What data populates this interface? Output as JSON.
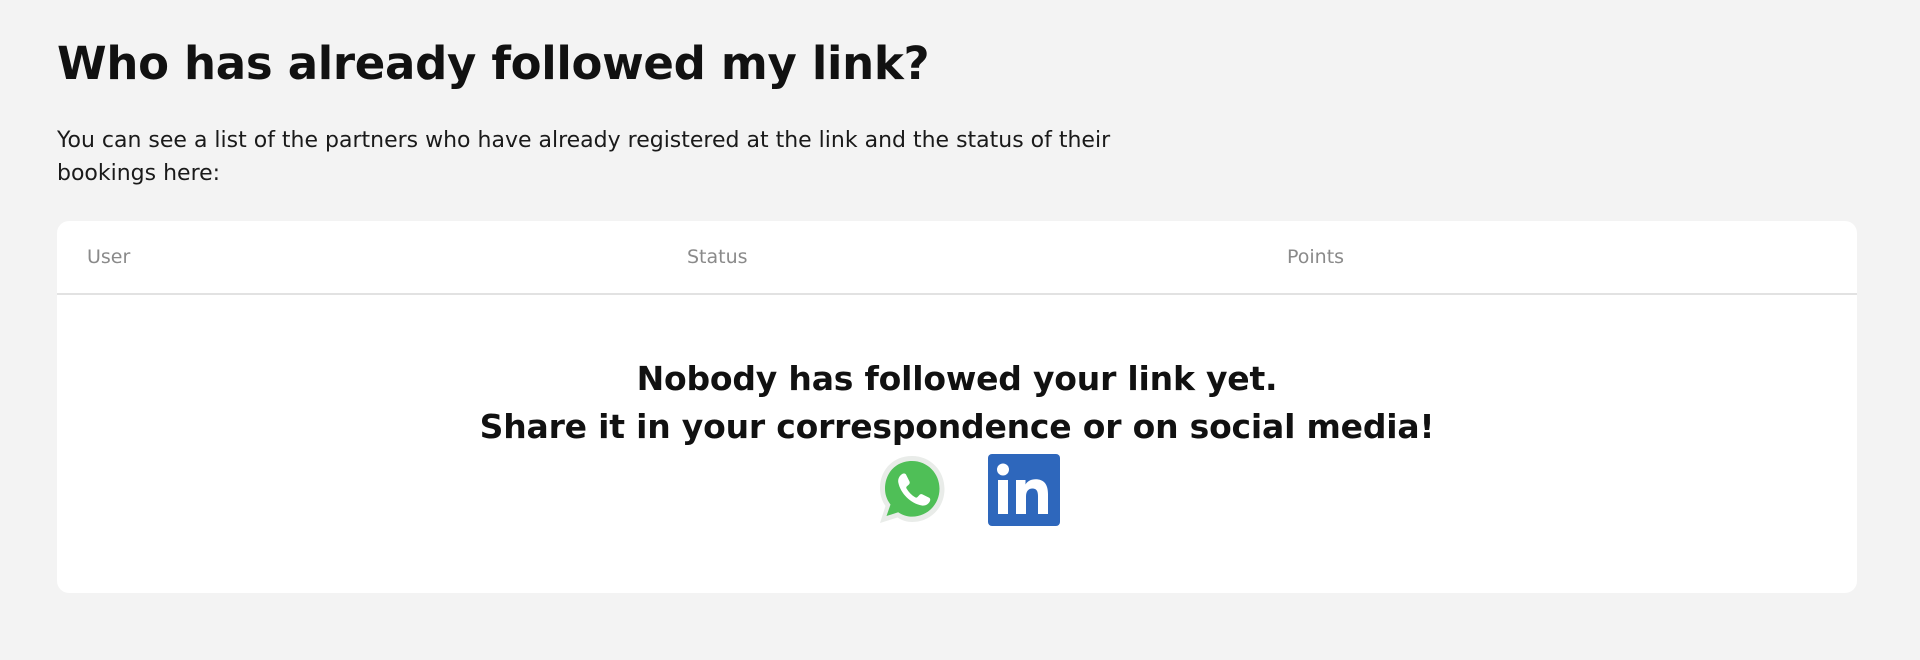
{
  "heading": "Who has already followed my link?",
  "intro": "You can see a list of the partners who have already registered at the link and the status of their bookings here:",
  "table": {
    "columns": [
      "User",
      "Status",
      "Points"
    ]
  },
  "empty_state": {
    "line1": "Nobody has followed your link yet.",
    "line2": "Share it in your correspondence or on social media!"
  },
  "share": {
    "icons": [
      "whatsapp-icon",
      "linkedin-icon"
    ]
  },
  "colors": {
    "background": "#f3f3f3",
    "card": "#ffffff",
    "whatsapp": "#4fbf57",
    "linkedin": "#2e67bc",
    "header_text": "#8a8a8a"
  }
}
